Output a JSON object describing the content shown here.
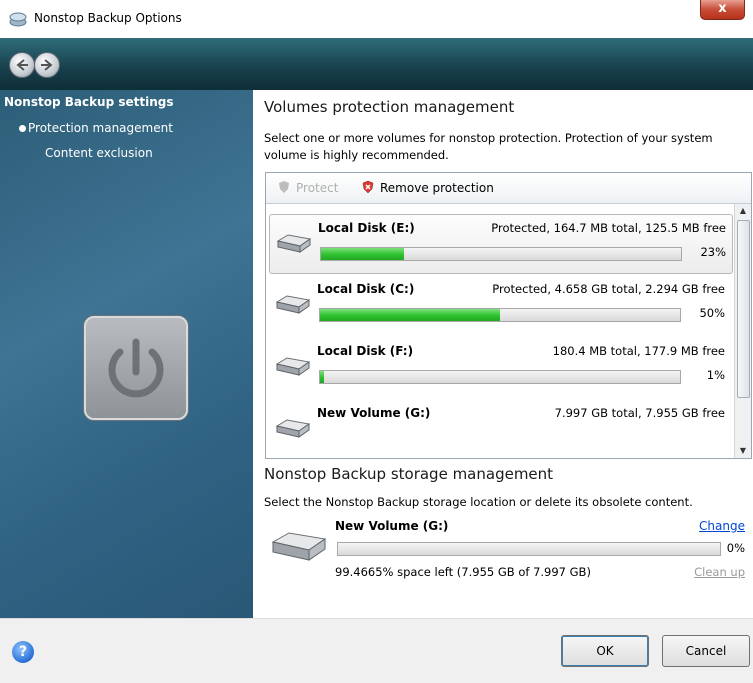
{
  "window": {
    "title": "Nonstop Backup Options",
    "close_label": "x"
  },
  "nav": {
    "back_icon": "back-arrow-icon",
    "forward_icon": "forward-arrow-icon"
  },
  "sidebar": {
    "heading": "Nonstop Backup settings",
    "items": [
      {
        "label": "Protection management",
        "selected": true
      },
      {
        "label": "Content exclusion",
        "selected": false
      }
    ]
  },
  "volumes": {
    "title": "Volumes protection management",
    "description": "Select one or more volumes for nonstop protection. Protection of your system volume is highly recommended.",
    "toolbar": {
      "protect": "Protect",
      "remove": "Remove protection"
    },
    "items": [
      {
        "name": "Local Disk (E:)",
        "info": "Protected, 164.7 MB total, 125.5 MB free",
        "percent_label": "23%",
        "fill": 0.23,
        "selected": true
      },
      {
        "name": "Local Disk (C:)",
        "info": "Protected, 4.658 GB total, 2.294 GB free",
        "percent_label": "50%",
        "fill": 0.5,
        "selected": false
      },
      {
        "name": "Local Disk (F:)",
        "info": "180.4 MB total, 177.9 MB free",
        "percent_label": "1%",
        "fill": 0.01,
        "selected": false
      },
      {
        "name": "New Volume (G:)",
        "info": "7.997 GB total, 7.955 GB free",
        "percent_label": "",
        "fill": 0,
        "selected": false
      }
    ]
  },
  "storage": {
    "title": "Nonstop Backup storage management",
    "description": "Select the Nonstop Backup storage location or delete its obsolete content.",
    "name": "New Volume (G:)",
    "change": "Change",
    "percent_label": "0%",
    "space": "99.4665% space left (7.955 GB of 7.997 GB)",
    "cleanup": "Clean up"
  },
  "footer": {
    "ok": "OK",
    "cancel": "Cancel",
    "help": "?"
  },
  "colors": {
    "accent_green": "#2ec22e",
    "nav_dark": "#173f4b",
    "sidebar_blue": "#3f7494"
  }
}
